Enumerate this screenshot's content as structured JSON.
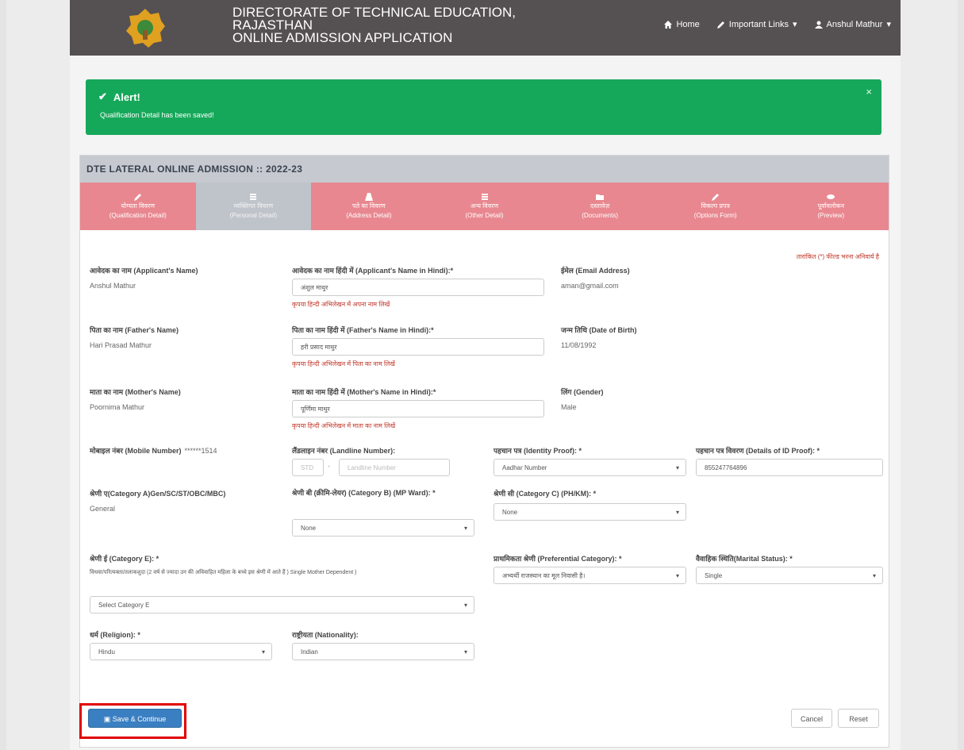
{
  "header": {
    "title_lines": [
      "DIRECTORATE OF TECHNICAL EDUCATION,",
      "RAJASTHAN",
      "ONLINE ADMISSION APPLICATION"
    ],
    "nav": {
      "home": "Home",
      "links": "Important Links",
      "user": "Anshul Mathur"
    }
  },
  "alert": {
    "title": "Alert!",
    "message": "Qualification Detail has been saved!",
    "close": "×"
  },
  "panel": {
    "title": "DTE LATERAL ONLINE ADMISSION :: 2022-23"
  },
  "tabs": [
    {
      "hi": "योग्यता विवरण",
      "en": "(Qualification Detail)"
    },
    {
      "hi": "व्यक्तिगत विवरण",
      "en": "(Personal Detail)"
    },
    {
      "hi": "पते का विवरण",
      "en": "(Address Detail)"
    },
    {
      "hi": "अन्य विवरण",
      "en": "(Other Detail)"
    },
    {
      "hi": "दस्तावेज़",
      "en": "(Documents)"
    },
    {
      "hi": "विकल्प प्रपत्र",
      "en": "(Options Form)"
    },
    {
      "hi": "पूर्वावलोकन",
      "en": "(Preview)"
    }
  ],
  "form": {
    "required_note": "तारांकित (*) फील्ड भरना अनिवार्य है",
    "applicant_name": {
      "label": "आवेदक का नाम (Applicant's Name)",
      "value": "Anshul Mathur"
    },
    "applicant_name_hindi": {
      "label": "आवेदक का नाम हिंदी में (Applicant's Name in Hindi):*",
      "value": "अंशुल माथुर",
      "error": "कृपया हिन्दी अभिलेखन में अपना नाम लिखें"
    },
    "email": {
      "label": "ईमेल (Email Address)",
      "value": "aman@gmail.com"
    },
    "father_name": {
      "label": "पिता का नाम (Father's Name)",
      "value": "Hari Prasad Mathur"
    },
    "father_name_hindi": {
      "label": "पिता का नाम हिंदी में (Father's Name in Hindi):*",
      "value": "हरी प्रसाद माथुर",
      "error": "कृपया हिन्दी अभिलेखन में पिता का नाम लिखें"
    },
    "dob": {
      "label": "जन्म तिथि (Date of Birth)",
      "value": "11/08/1992"
    },
    "mother_name": {
      "label": "माता का नाम (Mother's Name)",
      "value": "Poornima Mathur"
    },
    "mother_name_hindi": {
      "label": "माता का नाम हिंदी में (Mother's Name in Hindi):*",
      "value": "पूर्णिमा माथुर",
      "error": "कृपया हिन्दी अभिलेखन में माता का नाम लिखें"
    },
    "gender": {
      "label": "लिंग (Gender)",
      "value": "Male"
    },
    "mobile": {
      "label": "मोबाइल नंबर (Mobile Number)",
      "value": "******1514"
    },
    "landline": {
      "label": "लैंडलाइन नंबर (Landline Number):",
      "std_placeholder": "STD",
      "placeholder": "Landline Number"
    },
    "id_proof": {
      "label": "पहचान पत्र (Identity Proof): *",
      "value": "Aadhar Number"
    },
    "id_details": {
      "label": "पहचान पत्र विवरण (Details of ID Proof): *",
      "value": "855247764896"
    },
    "category_a": {
      "label": "श्रेणी ए(Category A)Gen/SC/ST/OBC/MBC)",
      "value": "General"
    },
    "category_b": {
      "label": "श्रेणी बी (क्रीमि-लेयर) (Category B) (MP Ward): *",
      "value": "None"
    },
    "category_c": {
      "label": "श्रेणी सी (Category C) (PH/KM): *",
      "value": "None"
    },
    "category_e": {
      "label": "श्रेणी ई (Category E): *",
      "desc": "विधवा/परित्यक्ता/तलाकशुदा (2 वर्ष से ज्यादा उन की अविवाहित महिला के बच्चे इस श्रेणी में आते हैं ) Single Mother Dependent )",
      "value": "Select Category E"
    },
    "preferential": {
      "label": "प्राथमिकता श्रेणी (Preferential Category): *",
      "value": "अभ्यर्थी राजस्थान का मूल निवासी है।"
    },
    "marital": {
      "label": "वैवाहिक स्थिति(Marital Status): *",
      "value": "Single"
    },
    "religion": {
      "label": "धर्म (Religion): *",
      "value": "Hindu"
    },
    "nationality": {
      "label": "राष्ट्रीयता (Nationality):",
      "value": "Indian"
    }
  },
  "buttons": {
    "save": "Save & Continue",
    "cancel": "Cancel",
    "reset": "Reset"
  }
}
